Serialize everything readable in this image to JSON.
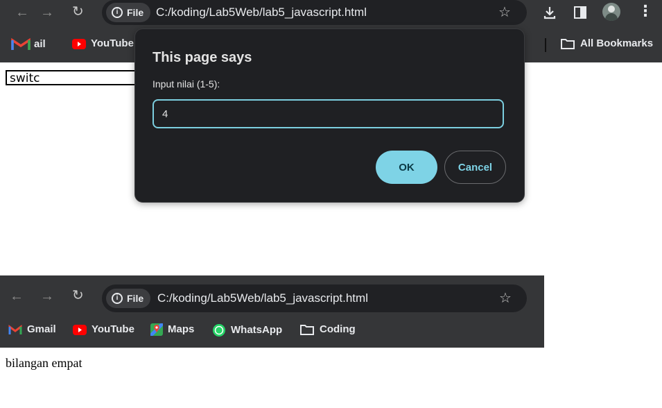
{
  "top_window": {
    "file_chip": "File",
    "url": "C:/koding/Lab5Web/lab5_javascript.html",
    "bookmarks": [
      {
        "label": "ail",
        "icon": "gmail-icon"
      },
      {
        "label": "YouTube",
        "icon": "youtube-icon"
      }
    ],
    "all_bookmarks_label": "All Bookmarks",
    "page_text": "switc"
  },
  "dialog": {
    "title": "This page says",
    "message": "Input nilai (1-5):",
    "input_value": "4",
    "ok_label": "OK",
    "cancel_label": "Cancel"
  },
  "bottom_window": {
    "file_chip": "File",
    "url": "C:/koding/Lab5Web/lab5_javascript.html",
    "bookmarks": [
      {
        "label": "Gmail",
        "icon": "gmail-icon"
      },
      {
        "label": "YouTube",
        "icon": "youtube-icon"
      },
      {
        "label": "Maps",
        "icon": "maps-icon"
      },
      {
        "label": "WhatsApp",
        "icon": "whatsapp-icon"
      },
      {
        "label": "Coding",
        "icon": "folder-icon"
      }
    ],
    "page_text": "bilangan empat"
  },
  "colors": {
    "chrome": "#353638",
    "omnibox": "#202124",
    "dialog_bg": "#1f2023",
    "accent": "#7ed3e6"
  }
}
